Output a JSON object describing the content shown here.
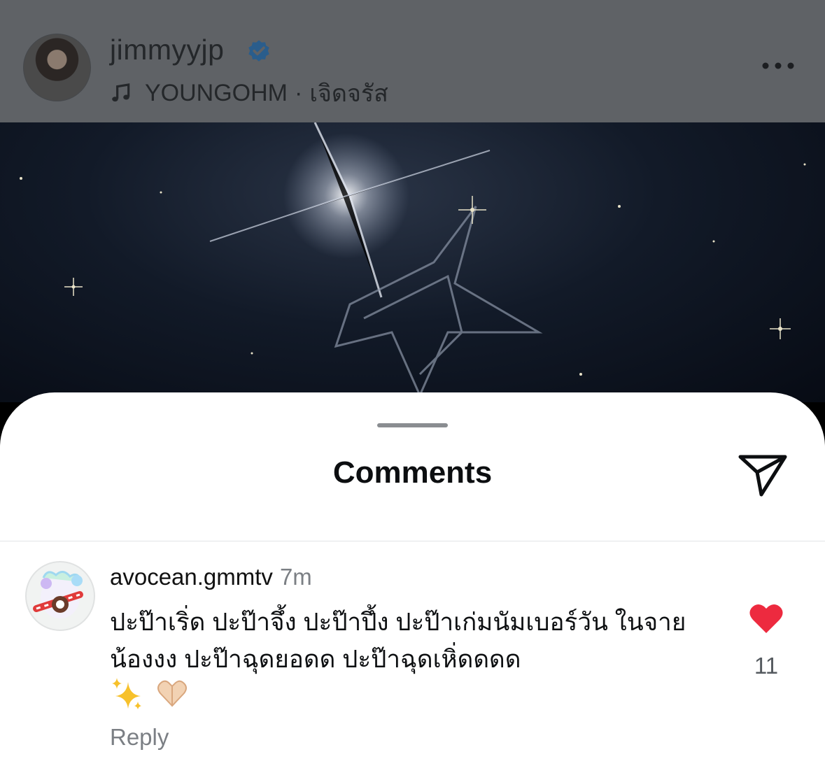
{
  "post": {
    "username": "jimmyyjp",
    "music_artist": "YOUNGOHM",
    "music_separator": "·",
    "music_title": "เจิดจรัส"
  },
  "sheet": {
    "title": "Comments"
  },
  "comment": {
    "username": "avocean.gmmtv",
    "time": "7m",
    "text": "ปะป๊าเริ่ด ปะป๊าจึ้ง ปะป๊าปึ้ง ปะป๊าเก่มนัมเบอร์วัน ในจายน้องงง ปะป๊าฉุดยอดด ปะป๊าฉุดเหิ่ดดดด",
    "emojis": [
      "sparkles",
      "heart-hands"
    ],
    "reply_label": "Reply",
    "like_count": "11"
  },
  "colors": {
    "heart": "#ed2a3f",
    "verified": "#2a5d8c"
  }
}
